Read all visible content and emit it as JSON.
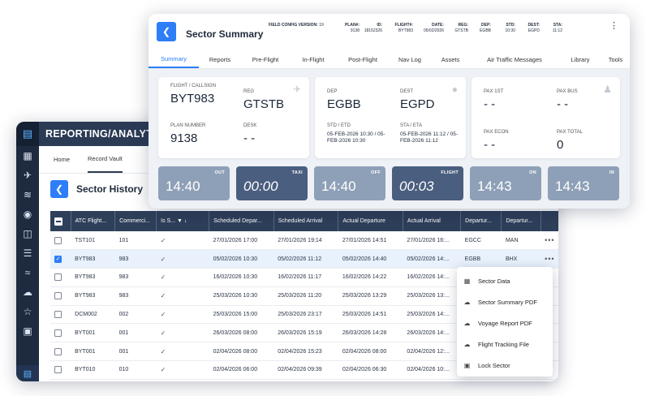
{
  "reporting": {
    "app_title": "REPORTING/ANALYTICS",
    "tabs": [
      {
        "label": "Home",
        "active": false
      },
      {
        "label": "Record Vault",
        "active": true
      }
    ],
    "page_title": "Sector History",
    "columns": [
      "ATC Flight...",
      "Commerci...",
      "Is S...",
      "Scheduled Depar...",
      "Scheduled Arrival",
      "Actual Departure",
      "Actual Arrival",
      "Departur...",
      "Departur..."
    ],
    "rows": [
      {
        "checked": false,
        "atc": "TST101",
        "commercial": "101",
        "sched_dep": "27/01/2026 17:00",
        "sched_arr": "27/01/2026 19:14",
        "act_dep": "27/01/2026 14:51",
        "act_arr": "27/01/2026 16:...",
        "dep1": "EGCC",
        "dep2": "MAN",
        "more": "•••"
      },
      {
        "checked": true,
        "atc": "BYT983",
        "commercial": "983",
        "sched_dep": "05/02/2026 10:30",
        "sched_arr": "05/02/2026 11:12",
        "act_dep": "05/02/2026 14:40",
        "act_arr": "05/02/2026 14:...",
        "dep1": "EGBB",
        "dep2": "BHX",
        "more": "•••"
      },
      {
        "checked": false,
        "atc": "BYT983",
        "commercial": "983",
        "sched_dep": "16/02/2026 10:30",
        "sched_arr": "16/02/2026 11:17",
        "act_dep": "16/02/2026 14:22",
        "act_arr": "16/02/2026 14:...",
        "dep1": "EG",
        "dep2": "",
        "more": ""
      },
      {
        "checked": false,
        "atc": "BYT983",
        "commercial": "983",
        "sched_dep": "25/03/2026 10:30",
        "sched_arr": "25/03/2026 11:20",
        "act_dep": "25/03/2026 13:29",
        "act_arr": "25/03/2026 13:...",
        "dep1": "EG",
        "dep2": "",
        "more": ""
      },
      {
        "checked": false,
        "atc": "DCM002",
        "commercial": "002",
        "sched_dep": "25/03/2026 15:00",
        "sched_arr": "25/03/2026 23:17",
        "act_dep": "25/03/2026 14:51",
        "act_arr": "25/03/2026 14:...",
        "dep1": "RJ",
        "dep2": "",
        "more": ""
      },
      {
        "checked": false,
        "atc": "BYT001",
        "commercial": "001",
        "sched_dep": "26/03/2026 08:00",
        "sched_arr": "26/03/2026 15:19",
        "act_dep": "26/03/2026 14:28",
        "act_arr": "26/03/2026 14:...",
        "dep1": "EG",
        "dep2": "",
        "more": ""
      },
      {
        "checked": false,
        "atc": "BYT001",
        "commercial": "001",
        "sched_dep": "02/04/2026 08:00",
        "sched_arr": "02/04/2026 15:23",
        "act_dep": "02/04/2026 08:00",
        "act_arr": "02/04/2026 12:...",
        "dep1": "EG",
        "dep2": "",
        "more": ""
      },
      {
        "checked": false,
        "atc": "BYT010",
        "commercial": "010",
        "sched_dep": "02/04/2026 06:00",
        "sched_arr": "02/04/2026 09:39",
        "act_dep": "02/04/2026 06:30",
        "act_arr": "02/04/2026 10:...",
        "dep1": "OJ",
        "dep2": "",
        "more": ""
      }
    ],
    "context_menu": [
      {
        "label": "Sector Data",
        "icon": "table-icon"
      },
      {
        "label": "Sector Summary PDF",
        "icon": "cloud-download-icon"
      },
      {
        "label": "Voyage Report PDF",
        "icon": "cloud-download-icon"
      },
      {
        "label": "Flight Tracking File",
        "icon": "cloud-download-icon"
      },
      {
        "label": "Lock Sector",
        "icon": "lock-icon"
      }
    ]
  },
  "summary": {
    "title": "Sector Summary",
    "field_config_label": "FIELD CONFIG VERSION:",
    "field_config_value": "19",
    "header_fields": [
      {
        "k": "PLAN#:",
        "v": "9138"
      },
      {
        "k": "ID:",
        "v": "18152326"
      },
      {
        "k": "FLIGHT#:",
        "v": "BYT983"
      },
      {
        "k": "DATE:",
        "v": "05/02/2026"
      },
      {
        "k": "REG:",
        "v": "GTSTB"
      },
      {
        "k": "DEP:",
        "v": "EGBB"
      },
      {
        "k": "STD:",
        "v": "10:30"
      },
      {
        "k": "DEST:",
        "v": "EGPD"
      },
      {
        "k": "STA:",
        "v": "11:12"
      }
    ],
    "tabs": [
      "Summary",
      "Reports",
      "Pre-Flight",
      "In-Flight",
      "Post-Flight",
      "Nav Log",
      "Assets",
      "Air Traffic Messages",
      "Library",
      "Tools"
    ],
    "active_tab": "Summary",
    "flight_card": {
      "callsign_label": "FLIGHT / CALLSIGN",
      "callsign": "BYT983",
      "reg_label": "REG",
      "reg": "GTSTB",
      "plan_label": "PLAN NUMBER",
      "plan": "9138",
      "desk_label": "DESK",
      "desk": "- -"
    },
    "route_card": {
      "dep_label": "DEP",
      "dep": "EGBB",
      "dest_label": "DEST",
      "dest": "EGPD",
      "std_label": "STD / ETD",
      "std": "05-FEB-2026 10:30 / 05-FEB-2026 10:30",
      "sta_label": "STA / ETA",
      "sta": "05-FEB-2026 11:12 / 05-FEB-2026 11:12"
    },
    "pax_card": {
      "pax1_label": "PAX 1ST",
      "pax1": "- -",
      "paxbus_label": "PAX BUS",
      "paxbus": "- -",
      "paxecon_label": "PAX ECON",
      "paxecon": "- -",
      "paxtotal_label": "PAX TOTAL",
      "paxtotal": "0"
    },
    "times": [
      {
        "time": "14:40",
        "label": "OUT",
        "style": "light",
        "italic": false
      },
      {
        "time": "00:00",
        "label": "TAXI",
        "style": "dark",
        "italic": true
      },
      {
        "time": "14:40",
        "label": "OFF",
        "style": "light",
        "italic": false
      },
      {
        "time": "00:03",
        "label": "FLIGHT",
        "style": "dark",
        "italic": true
      },
      {
        "time": "14:43",
        "label": "ON",
        "style": "light",
        "italic": false
      },
      {
        "time": "14:43",
        "label": "IN",
        "style": "light",
        "italic": false
      }
    ]
  }
}
